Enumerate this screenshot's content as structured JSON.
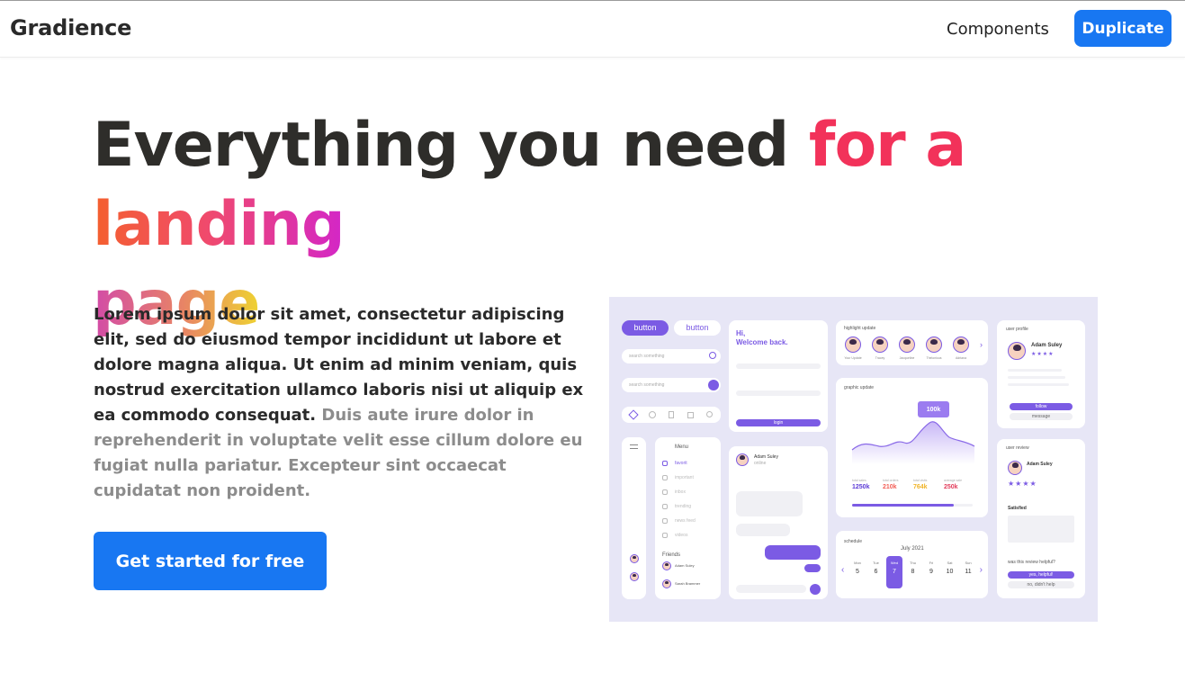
{
  "header": {
    "brand": "Gradience",
    "nav_link": "Components",
    "cta": "Duplicate"
  },
  "hero": {
    "headline_dark": "Everything you need ",
    "headline_accent_1": "for a ",
    "headline_accent_2": "landing",
    "headline_accent_3": "page",
    "lede_dark": "Lorem ipsum dolor sit amet, consectetur adipiscing elit, sed do eiusmod tempor incididunt ut labore et dolore magna aliqua. Ut enim ad minim veniam, quis nostrud exercitation ullamco laboris nisi ut aliquip ex ea commodo consequat.",
    "lede_muted": "Duis aute irure dolor in reprehenderit in voluptate velit esse cillum dolore eu fugiat nulla pariatur. Excepteur sint occaecat cupidatat non proident.",
    "cta": "Get started for free"
  },
  "preview": {
    "button_primary": "button",
    "button_secondary": "button",
    "search_placeholder": "search something",
    "welcome": "Hi,\nWelcome back.",
    "login_button": "login",
    "highlight_title": "highlight update",
    "highlight_names": [
      "Your Update",
      "Tracey",
      "Jacqueline",
      "Thelonious",
      "Adriana"
    ],
    "graphic_title": "graphic update",
    "graphic_badge": "100k",
    "stats": [
      {
        "label": "total sales",
        "value": "1250k",
        "color": "#5b3ad6"
      },
      {
        "label": "total orders",
        "value": "210k",
        "color": "#f25c54"
      },
      {
        "label": "total visits",
        "value": "764k",
        "color": "#f0b429"
      },
      {
        "label": "average sale",
        "value": "250k",
        "color": "#e23b5a"
      }
    ],
    "progress_value": 0.84,
    "menu_title": "Menu",
    "menu_items": [
      "favorit",
      "important",
      "inbox",
      "trending",
      "news feed",
      "videos"
    ],
    "friends_title": "Friends",
    "friends": [
      "Adam Suley",
      "Sarah Brammer"
    ],
    "chat_name": "Adam Suley",
    "chat_status": "online",
    "profile_title": "user profile",
    "profile_name": "Adam Suley",
    "follow_button": "follow",
    "message_button": "message",
    "review_title": "user review",
    "review_name": "Adam Suley",
    "review_label": "Satisfied",
    "review_question": "was this review helpful?",
    "review_yes": "yes, helpful!",
    "review_no": "no, didn't help",
    "schedule_title": "schedule",
    "schedule_month": "July 2021",
    "schedule_days": [
      {
        "d": "Mon",
        "n": "5"
      },
      {
        "d": "Tue",
        "n": "6"
      },
      {
        "d": "Wed",
        "n": "7"
      },
      {
        "d": "Thu",
        "n": "8"
      },
      {
        "d": "Fri",
        "n": "9"
      },
      {
        "d": "Sat",
        "n": "10"
      },
      {
        "d": "Sun",
        "n": "11"
      }
    ],
    "schedule_selected_index": 2,
    "colors": {
      "accent": "#7b5be4",
      "backdrop": "#e7e6f6",
      "brand_blue": "#1877f2"
    }
  }
}
